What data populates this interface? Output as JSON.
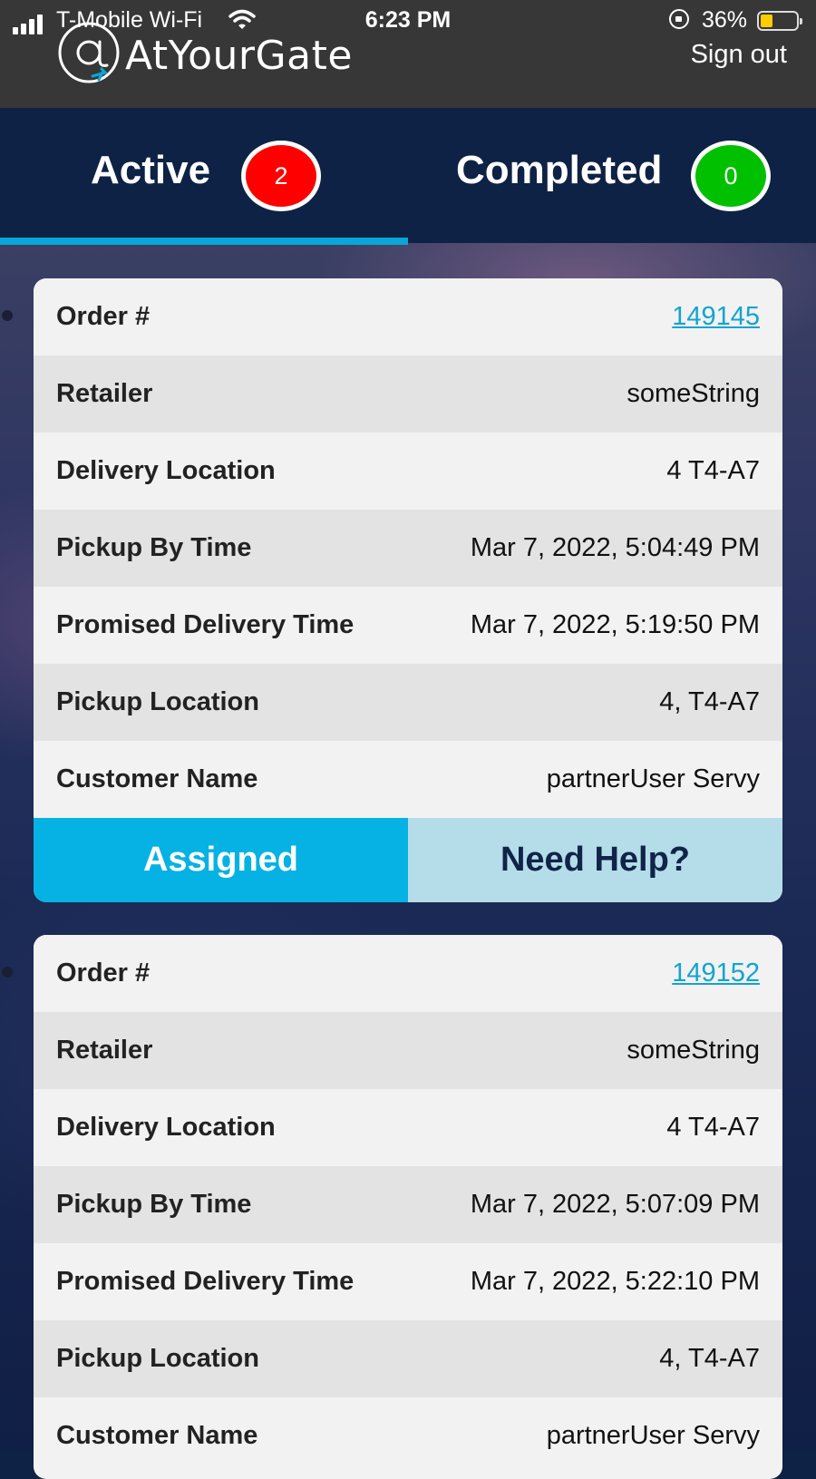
{
  "status_bar": {
    "carrier": "T-Mobile Wi-Fi",
    "time": "6:23 PM",
    "battery": "36%"
  },
  "header": {
    "brand": "AtYourGate",
    "sign_out": "Sign out"
  },
  "tabs": [
    {
      "label": "Active",
      "count": "2",
      "badge_color": "#ff0000",
      "selected": true
    },
    {
      "label": "Completed",
      "count": "0",
      "badge_color": "#00c000",
      "selected": false
    }
  ],
  "accent_color": "#0aa6d8",
  "orders": [
    {
      "rows": [
        {
          "label": "Order #",
          "value": "149145"
        },
        {
          "label": "Retailer",
          "value": "someString"
        },
        {
          "label": "Delivery Location",
          "value": "4 T4-A7"
        },
        {
          "label": "Pickup By Time",
          "value": "Mar 7, 2022, 5:04:49 PM"
        },
        {
          "label": "Promised Delivery Time",
          "value": "Mar 7, 2022, 5:19:50 PM"
        },
        {
          "label": "Pickup Location",
          "value": "4, T4-A7"
        },
        {
          "label": "Customer Name",
          "value": "partnerUser Servy"
        }
      ],
      "status_button": "Assigned",
      "help_button": "Need Help?"
    },
    {
      "rows": [
        {
          "label": "Order #",
          "value": "149152"
        },
        {
          "label": "Retailer",
          "value": "someString"
        },
        {
          "label": "Delivery Location",
          "value": "4 T4-A7"
        },
        {
          "label": "Pickup By Time",
          "value": "Mar 7, 2022, 5:07:09 PM"
        },
        {
          "label": "Promised Delivery Time",
          "value": "Mar 7, 2022, 5:22:10 PM"
        },
        {
          "label": "Pickup Location",
          "value": "4, T4-A7"
        },
        {
          "label": "Customer Name",
          "value": "partnerUser Servy"
        }
      ]
    }
  ]
}
